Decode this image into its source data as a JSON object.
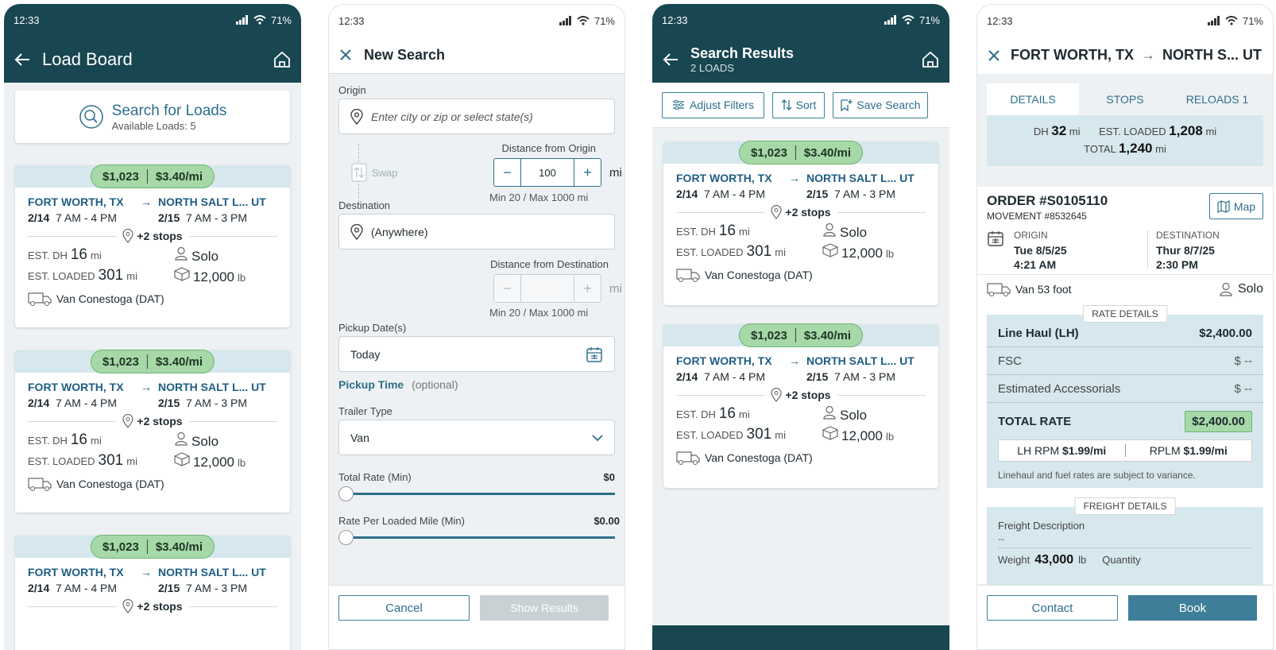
{
  "status": {
    "time": "12:33",
    "battery": "71%"
  },
  "load_board": {
    "title": "Load Board",
    "search_title": "Search for Loads",
    "available": "Available Loads: 5",
    "cards": [
      {
        "price": "$1,023",
        "rpm": "$3.40/mi",
        "origin": "FORT WORTH, TX",
        "dest": "NORTH SALT L... UT",
        "o_date": "2/14",
        "o_time": "7 AM - 4 PM",
        "d_date": "2/15",
        "d_time": "7 AM - 3 PM",
        "stops": "+2 stops",
        "dh_label": "EST. DH",
        "dh": "16",
        "dh_unit": "mi",
        "loaded_label": "EST. LOADED",
        "loaded": "301",
        "loaded_unit": "mi",
        "team": "Solo",
        "weight": "12,000",
        "weight_unit": "lb",
        "equipment": "Van Conestoga (DAT)"
      },
      {
        "price": "$1,023",
        "rpm": "$3.40/mi",
        "origin": "FORT WORTH, TX",
        "dest": "NORTH SALT L... UT",
        "o_date": "2/14",
        "o_time": "7 AM - 4 PM",
        "d_date": "2/15",
        "d_time": "7 AM - 3 PM",
        "stops": "+2 stops",
        "dh_label": "EST. DH",
        "dh": "16",
        "dh_unit": "mi",
        "loaded_label": "EST. LOADED",
        "loaded": "301",
        "loaded_unit": "mi",
        "team": "Solo",
        "weight": "12,000",
        "weight_unit": "lb",
        "equipment": "Van Conestoga (DAT)"
      },
      {
        "price": "$1,023",
        "rpm": "$3.40/mi",
        "origin": "FORT WORTH, TX",
        "dest": "NORTH SALT L... UT",
        "o_date": "2/14",
        "o_time": "7 AM - 4 PM",
        "d_date": "2/15",
        "d_time": "7 AM - 3 PM",
        "stops": "+2 stops"
      }
    ]
  },
  "new_search": {
    "title": "New Search",
    "origin_label": "Origin",
    "origin_placeholder": "Enter city or zip or select state(s)",
    "swap": "Swap",
    "dist_origin_label": "Distance from Origin",
    "dist_origin_value": "100",
    "unit": "mi",
    "minmax": "Min 20 / Max 1000 mi",
    "destination_label": "Destination",
    "destination_value": "(Anywhere)",
    "dist_dest_label": "Distance from Destination",
    "pickup_label": "Pickup Date(s)",
    "pickup_value": "Today",
    "pickup_time": "Pickup Time",
    "optional": "(optional)",
    "trailer_label": "Trailer Type",
    "trailer_value": "Van",
    "total_rate_label": "Total Rate (Min)",
    "total_rate_value": "$0",
    "rpm_label": "Rate Per Loaded Mile (Min)",
    "rpm_value": "$0.00",
    "cancel": "Cancel",
    "show_results": "Show Results"
  },
  "results": {
    "title": "Search Results",
    "subtitle": "2 LOADS",
    "adjust": "Adjust Filters",
    "sort": "Sort",
    "save": "Save Search"
  },
  "details": {
    "title_origin": "FORT WORTH, TX",
    "title_dest": "NORTH S... UT",
    "tabs": [
      "DETAILS",
      "STOPS",
      "RELOADS 1"
    ],
    "dh_label": "DH",
    "dh": "32",
    "unit": "mi",
    "est_loaded_label": "EST. LOADED",
    "est_loaded": "1,208",
    "total_label": "TOTAL",
    "total": "1,240",
    "order": "ORDER #S0105110",
    "movement": "MOVEMENT #8532645",
    "map": "Map",
    "origin_label": "ORIGIN",
    "origin_date": "Tue 8/5/25",
    "origin_time": "4:21 AM",
    "dest_label": "DESTINATION",
    "dest_date": "Thur 8/7/25",
    "dest_time": "2:30 PM",
    "equipment": "Van 53 foot",
    "team": "Solo",
    "rate_details": "RATE DETAILS",
    "line_haul_label": "Line Haul (LH)",
    "line_haul": "$2,400.00",
    "fsc_label": "FSC",
    "fsc": "$ --",
    "acc_label": "Estimated Accessorials",
    "acc": "$ --",
    "total_rate_label": "TOTAL RATE",
    "total_rate": "$2,400.00",
    "lh_rpm_label": "LH RPM",
    "lh_rpm": "$1.99/mi",
    "rplm_label": "RPLM",
    "rplm": "$1.99/mi",
    "disclaimer": "Linehaul and fuel rates are subject to variance.",
    "freight_details": "FREIGHT DETAILS",
    "freight_desc_label": "Freight Description",
    "freight_desc": "--",
    "weight_label": "Weight",
    "weight": "43,000",
    "weight_unit": "lb",
    "quantity_label": "Quantity",
    "contact": "Contact",
    "book": "Book"
  }
}
